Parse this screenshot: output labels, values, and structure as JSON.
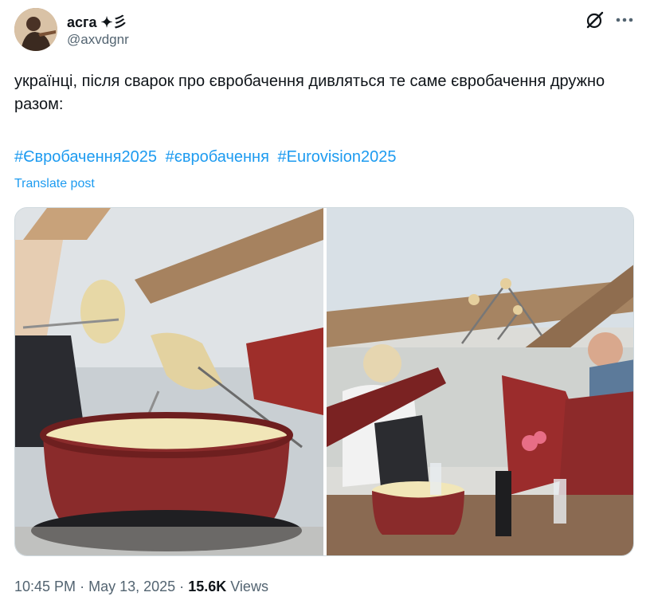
{
  "user": {
    "name": "асга ✦彡",
    "handle": "@axvdgnr"
  },
  "post": {
    "text": "українці, після сварок про євробачення дивляться те саме євробачення дружно разом:",
    "hashtags": [
      "#Євробачення2025",
      "#євробачення",
      "#Eurovision2025"
    ],
    "translate_label": "Translate post"
  },
  "icons": {
    "grok": "grok-icon",
    "more": "more-icon"
  },
  "meta": {
    "time": "10:45 PM",
    "separator": "·",
    "date": "May 13, 2025",
    "views_count": "15.6K",
    "views_label": "Views"
  },
  "colors": {
    "accent": "#1d9bf0",
    "secondary_text": "#536471",
    "pot": "#8a2b2b"
  }
}
